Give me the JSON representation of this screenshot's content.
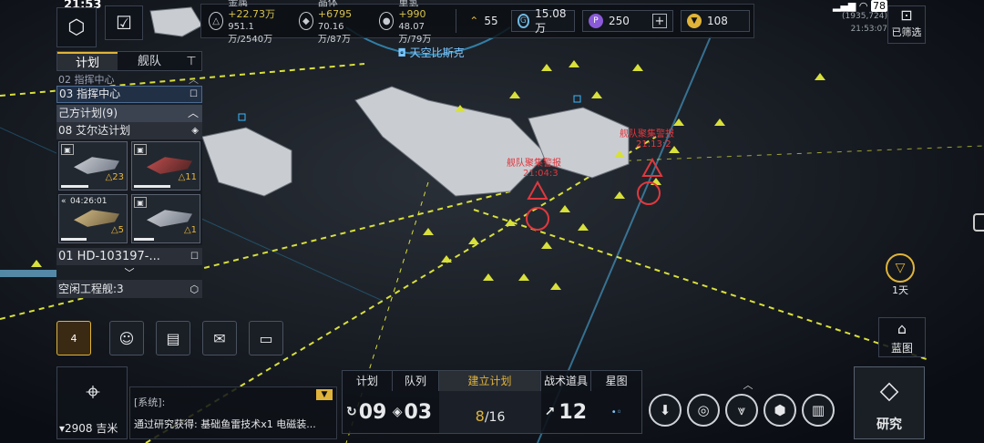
{
  "status": {
    "clock": "21:53",
    "time_lines": [
      "(1935,724)",
      "21:53:07"
    ],
    "battery": "78"
  },
  "resources": [
    {
      "key": "metal",
      "icon": "metal-icon",
      "name": "金属",
      "gain": "+22.73万",
      "value": "951.1万/2540万"
    },
    {
      "key": "crystal",
      "icon": "crystal-icon",
      "name": "晶体",
      "gain": "+6795",
      "value": "70.16万/87万"
    },
    {
      "key": "deuterium",
      "icon": "deuterium-icon",
      "name": "重氢",
      "gain": "+990",
      "value": "48.07万/79万"
    }
  ],
  "chips": {
    "ships": "55",
    "energy": "15.08万",
    "premium": "250",
    "gold": "108"
  },
  "topright": {
    "filter_label": "已筛选"
  },
  "side_tabs": {
    "plan": "计划",
    "fleet": "舰队"
  },
  "side_list": {
    "row1": "02 指挥中心",
    "row2": "03 指挥中心",
    "group": "己方计划(9)",
    "plan": "08 艾尔达计划",
    "cards": [
      {
        "level": "△23",
        "timer": ""
      },
      {
        "level": "△11",
        "timer": ""
      },
      {
        "level": "△5",
        "timer": "04:26:01"
      },
      {
        "level": "△1",
        "timer": ""
      }
    ],
    "target": "01 HD-103197-...",
    "idle": "空闲工程舰:3"
  },
  "map": {
    "location_label": "天空比斯克",
    "warnings": [
      {
        "text": "舰队聚集警报",
        "timer": "21:04:3"
      },
      {
        "text": "舰队聚集警报",
        "timer": "21:13:2"
      }
    ],
    "days": "1天",
    "blueprint": "蓝图"
  },
  "level_badge": "4",
  "distance": {
    "value": "2908",
    "unit": "吉米"
  },
  "chat": {
    "channel": "[系统]:",
    "message": "通过研究获得: 基础鱼雷技术x1 电磁装..."
  },
  "command": {
    "tabs": [
      "计划",
      "队列",
      "建立计划",
      "战术道具",
      "星图"
    ],
    "plans": "09",
    "queue": "03",
    "built": "8",
    "built_total": "/16",
    "items": "12"
  },
  "research_label": "研究",
  "colors": {
    "accent": "#e0b43a",
    "warning": "#e0383e",
    "ship_marker": "#d8e03a"
  }
}
